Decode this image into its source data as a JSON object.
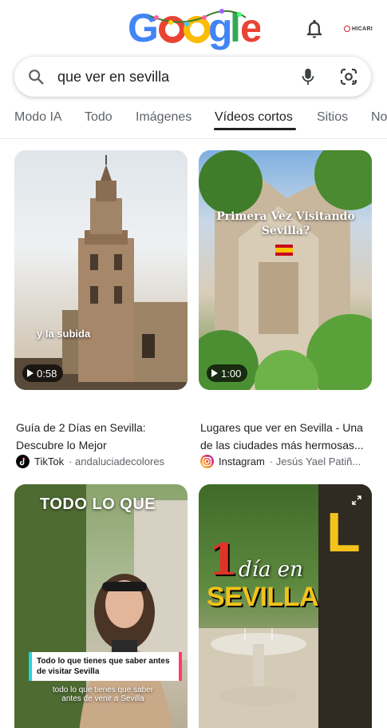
{
  "header": {
    "logo_alt": "Google",
    "avatar_label": "HICARI"
  },
  "search": {
    "query": "que ver en sevilla"
  },
  "tabs": [
    {
      "label": "Modo IA"
    },
    {
      "label": "Todo"
    },
    {
      "label": "Imágenes"
    },
    {
      "label": "Vídeos cortos",
      "active": true
    },
    {
      "label": "Sitios"
    },
    {
      "label": "No"
    }
  ],
  "videos": [
    {
      "duration": "0:58",
      "overlay": "y la subida",
      "title": "Guía de 2 Días en Sevilla: Descubre lo Mejor",
      "platform": "TikTok",
      "author": "· andaluciadecolores"
    },
    {
      "duration": "1:00",
      "overlay": "Primera Vez Visitando Sevilla?",
      "title": "Lugares que ver en Sevilla - Una de las ciudades más hermosas...",
      "platform": "Instagram",
      "author": "· Jesús Yael Patiñ..."
    },
    {
      "overlay_top": "TODO LO QUE",
      "overlay_box": "Todo lo que tienes que saber antes de visitar Sevilla",
      "overlay_sub": "todo lo que tienes que saber antes de venir a Sevilla"
    },
    {
      "overlay_num": "1",
      "overlay_script": "día en",
      "overlay_city": "SEVILLA",
      "overlay_side": "L"
    }
  ],
  "colors": {
    "google_blue": "#4285f4",
    "google_red": "#ea4335",
    "google_yellow": "#fbbc05",
    "google_green": "#34a853",
    "text_primary": "#202124",
    "text_secondary": "#5f6368"
  }
}
